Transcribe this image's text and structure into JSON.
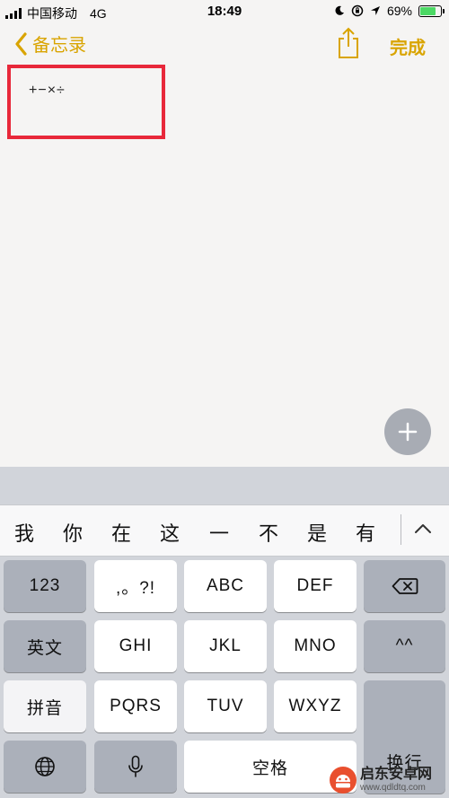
{
  "status_bar": {
    "carrier": "中国移动",
    "network": "4G",
    "time": "18:49",
    "battery_percent": "69%",
    "battery_level": 0.69
  },
  "nav": {
    "back_label": "备忘录",
    "done_label": "完成",
    "accent_color": "#d9a400"
  },
  "note": {
    "text": "+−×÷",
    "highlight_color": "#e8283a"
  },
  "keyboard": {
    "candidates": [
      "我",
      "你",
      "在",
      "这",
      "一",
      "不",
      "是",
      "有"
    ],
    "keys": {
      "k123": "123",
      "punct": ",。?!",
      "abc": "ABC",
      "def": "DEF",
      "english": "英文",
      "ghi": "GHI",
      "jkl": "JKL",
      "mno": "MNO",
      "emoticon": "^^",
      "pinyin": "拼音",
      "pqrs": "PQRS",
      "tuv": "TUV",
      "wxyz": "WXYZ",
      "return": "换行",
      "space": "空格"
    }
  },
  "watermark": {
    "title": "启东安卓网",
    "url": "www.qdldtq.com"
  }
}
